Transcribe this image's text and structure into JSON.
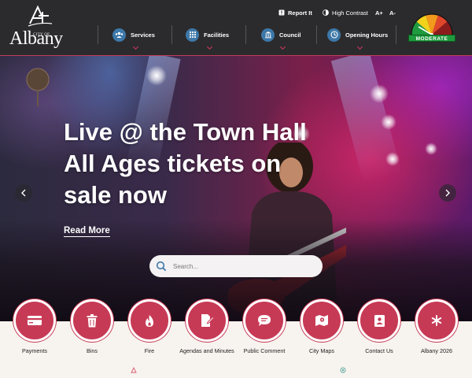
{
  "header": {
    "logo": {
      "small_text": "CITY OF",
      "name": "Albany"
    },
    "utility": {
      "report_it": "Report It",
      "high_contrast": "High Contrast",
      "font_larger": "A+",
      "font_smaller": "A-"
    },
    "nav": [
      {
        "label": "Services",
        "icon": "people-icon"
      },
      {
        "label": "Facilities",
        "icon": "grid-icon"
      },
      {
        "label": "Council",
        "icon": "building-icon"
      },
      {
        "label": "Opening Hours",
        "icon": "clock-icon"
      }
    ],
    "fire_danger": {
      "rating": "MODERATE",
      "color": "#1f9a3e"
    }
  },
  "hero": {
    "headline": "Live @ the Town Hall All Ages tickets on sale now",
    "cta": "Read More",
    "search_placeholder": "Search..."
  },
  "quick_links": [
    {
      "label": "Payments",
      "icon": "card-icon"
    },
    {
      "label": "Bins",
      "icon": "bin-icon"
    },
    {
      "label": "Fire",
      "icon": "flame-icon"
    },
    {
      "label": "Agendas and Minutes",
      "icon": "document-edit-icon"
    },
    {
      "label": "Public Comment",
      "icon": "speech-bubble-icon"
    },
    {
      "label": "City Maps",
      "icon": "map-icon"
    },
    {
      "label": "Contact Us",
      "icon": "contact-card-icon"
    },
    {
      "label": "Albany 2026",
      "icon": "asterisk-icon"
    }
  ],
  "colors": {
    "accent": "#c73a55",
    "header_bg": "#2b2b2d",
    "nav_icon": "#3d78a8"
  }
}
